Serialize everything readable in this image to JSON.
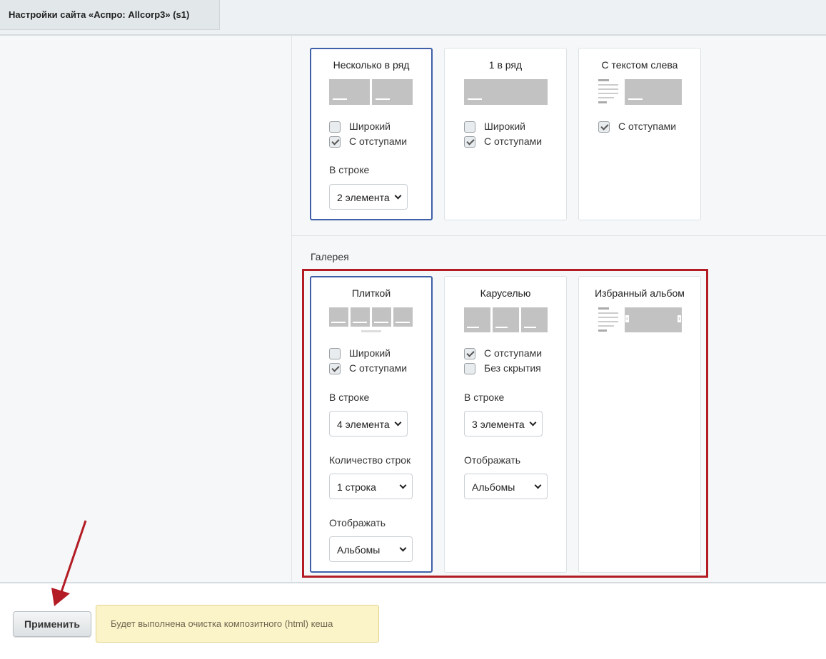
{
  "tab": {
    "title": "Настройки сайта «Аспро: Allcorp3» (s1)"
  },
  "top_cards": [
    {
      "title": "Несколько в ряд",
      "checkboxes": [
        {
          "label": "Широкий",
          "checked": false
        },
        {
          "label": "С отступами",
          "checked": true
        }
      ],
      "field_label": "В строке",
      "select_value": "2 элемента",
      "selected": true
    },
    {
      "title": "1 в ряд",
      "checkboxes": [
        {
          "label": "Широкий",
          "checked": false
        },
        {
          "label": "С отступами",
          "checked": true
        }
      ]
    },
    {
      "title": "С текстом слева",
      "checkboxes": [
        {
          "label": "С отступами",
          "checked": true
        }
      ]
    }
  ],
  "gallery": {
    "section_title": "Галерея",
    "cards": [
      {
        "title": "Плиткой",
        "selected": true,
        "checkboxes": [
          {
            "label": "Широкий",
            "checked": false
          },
          {
            "label": "С отступами",
            "checked": true
          }
        ],
        "fields": [
          {
            "label": "В строке",
            "value": "4 элемента"
          },
          {
            "label": "Количество строк",
            "value": "1 строка"
          },
          {
            "label": "Отображать",
            "value": "Альбомы"
          }
        ]
      },
      {
        "title": "Каруселью",
        "checkboxes": [
          {
            "label": "С отступами",
            "checked": true
          },
          {
            "label": "Без скрытия",
            "checked": false
          }
        ],
        "fields": [
          {
            "label": "В строке",
            "value": "3 элемента"
          },
          {
            "label": "Отображать",
            "value": "Альбомы"
          }
        ]
      },
      {
        "title": "Избранный альбом"
      }
    ]
  },
  "bottom": {
    "apply_label": "Применить",
    "notice": "Будет выполнена очистка композитного (html) кеша"
  },
  "colors": {
    "selected_border": "#3f5fa8",
    "highlight_frame": "#b31c24",
    "notice_bg": "#fcf4c9"
  }
}
